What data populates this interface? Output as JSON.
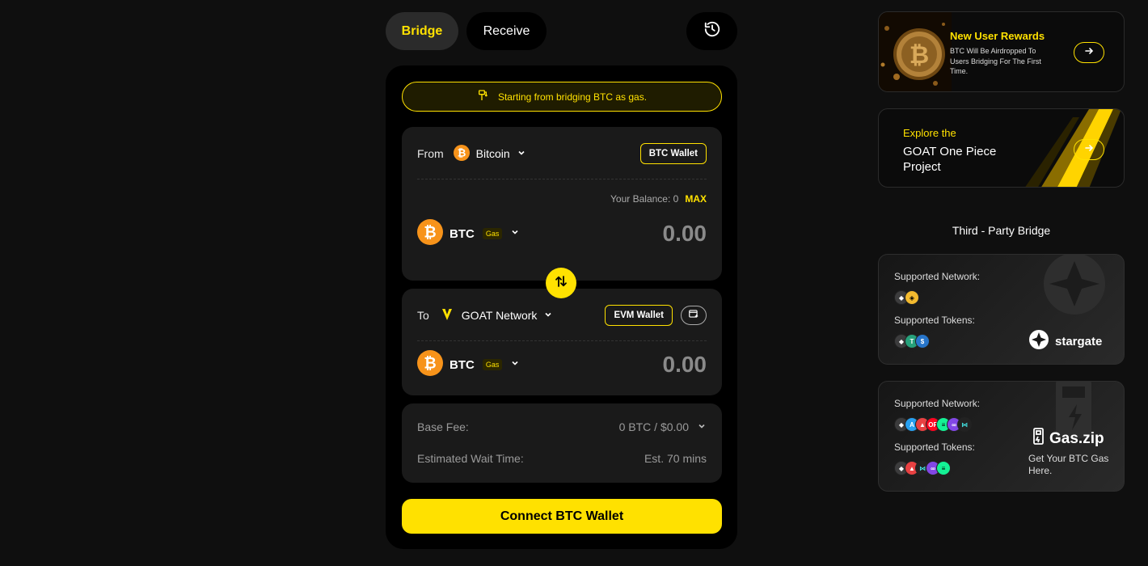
{
  "tabs": {
    "bridge": "Bridge",
    "receive": "Receive"
  },
  "notice": "Starting from bridging BTC as gas.",
  "from": {
    "label": "From",
    "network": "Bitcoin",
    "wallet_button": "BTC Wallet",
    "balance_label": "Your Balance: 0",
    "max_label": "MAX",
    "token": "BTC",
    "gas_tag": "Gas",
    "amount": "0.00"
  },
  "to": {
    "label": "To",
    "network": "GOAT Network",
    "wallet_button": "EVM Wallet",
    "token": "BTC",
    "gas_tag": "Gas",
    "amount": "0.00"
  },
  "fees": {
    "base_fee_label": "Base Fee:",
    "base_fee_value": "0 BTC / $0.00",
    "wait_label": "Estimated Wait Time:",
    "wait_value": "Est. 70 mins"
  },
  "connect_button": "Connect BTC Wallet",
  "promos": [
    {
      "title": "New User Rewards",
      "desc": "BTC Will Be Airdropped To Users Bridging For The First Time."
    },
    {
      "kicker": "Explore the",
      "title": "GOAT One Piece Project"
    }
  ],
  "third_party_title": "Third - Party Bridge",
  "bridges": [
    {
      "network_label": "Supported Network:",
      "tokens_label": "Supported Tokens:",
      "brand": "stargate"
    },
    {
      "network_label": "Supported Network:",
      "tokens_label": "Supported Tokens:",
      "brand": "Gas.zip",
      "brand_desc": "Get Your BTC Gas Here."
    }
  ],
  "colors": {
    "accent": "#ffe100",
    "bitcoin": "#f7931a",
    "bg": "#0f0f0f",
    "card": "#000000",
    "panel": "#1a1a1a"
  }
}
